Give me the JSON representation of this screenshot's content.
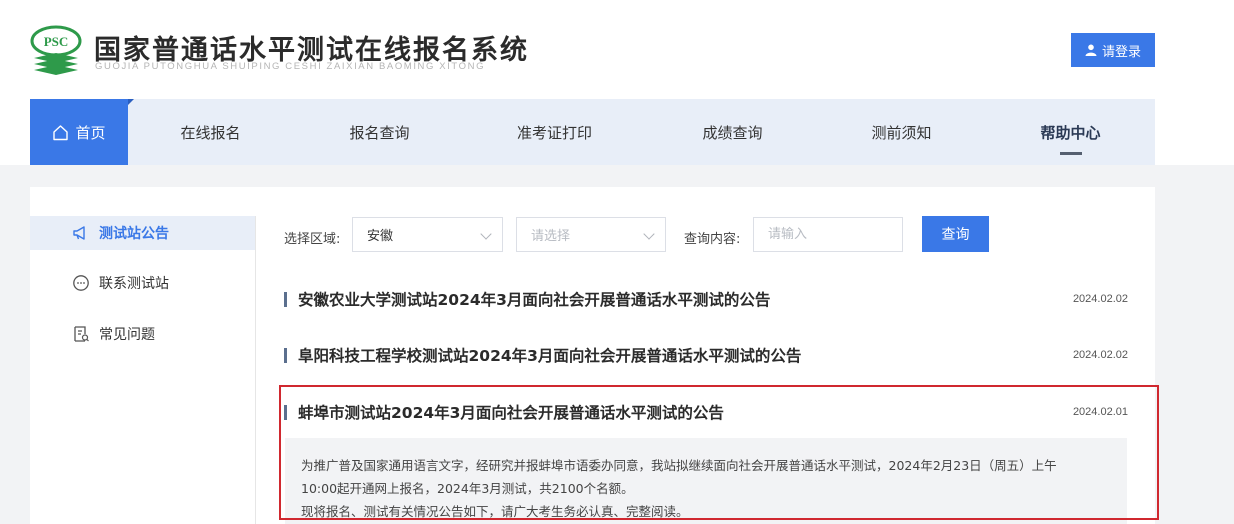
{
  "header": {
    "title": "国家普通话水平测试在线报名系统",
    "subtitle": "GUOJIA PUTONGHUA SHUIPING CESHI ZAIXIAN BAOMING XITONG",
    "logo_text": "PSC",
    "login_label": "请登录"
  },
  "nav": {
    "items": [
      "首页",
      "在线报名",
      "报名查询",
      "准考证打印",
      "成绩查询",
      "测前须知",
      "帮助中心"
    ],
    "active_index": 0
  },
  "sidebar": {
    "items": [
      {
        "label": "测试站公告",
        "icon": "megaphone-icon",
        "active": true
      },
      {
        "label": "联系测试站",
        "icon": "chat-bubble-icon",
        "active": false
      },
      {
        "label": "常见问题",
        "icon": "document-question-icon",
        "active": false
      }
    ]
  },
  "filter": {
    "region_label": "选择区域:",
    "province_value": "安徽",
    "city_placeholder": "请选择",
    "search_label": "查询内容:",
    "search_placeholder": "请输入",
    "query_label": "查询"
  },
  "notices": [
    {
      "title": "安徽农业大学测试站2024年3月面向社会开展普通话水平测试的公告",
      "date": "2024.02.02"
    },
    {
      "title": "阜阳科技工程学校测试站2024年3月面向社会开展普通话水平测试的公告",
      "date": "2024.02.02"
    },
    {
      "title": "蚌埠市测试站2024年3月面向社会开展普通话水平测试的公告",
      "date": "2024.02.01",
      "description": [
        "为推广普及国家通用语言文字，经研究并报蚌埠市语委办同意，我站拟继续面向社会开展普通话水平测试，2024年2月23日（周五）上午",
        "10:00起开通网上报名，2024年3月测试，共2100个名额。",
        "现将报名、测试有关情况公告如下，请广大考生务必认真、完整阅读。"
      ]
    }
  ],
  "colors": {
    "accent": "#3a78e7",
    "nav_bg": "#e8eef8",
    "highlight_border": "#d0282f",
    "logo_green": "#2e9a4a"
  }
}
